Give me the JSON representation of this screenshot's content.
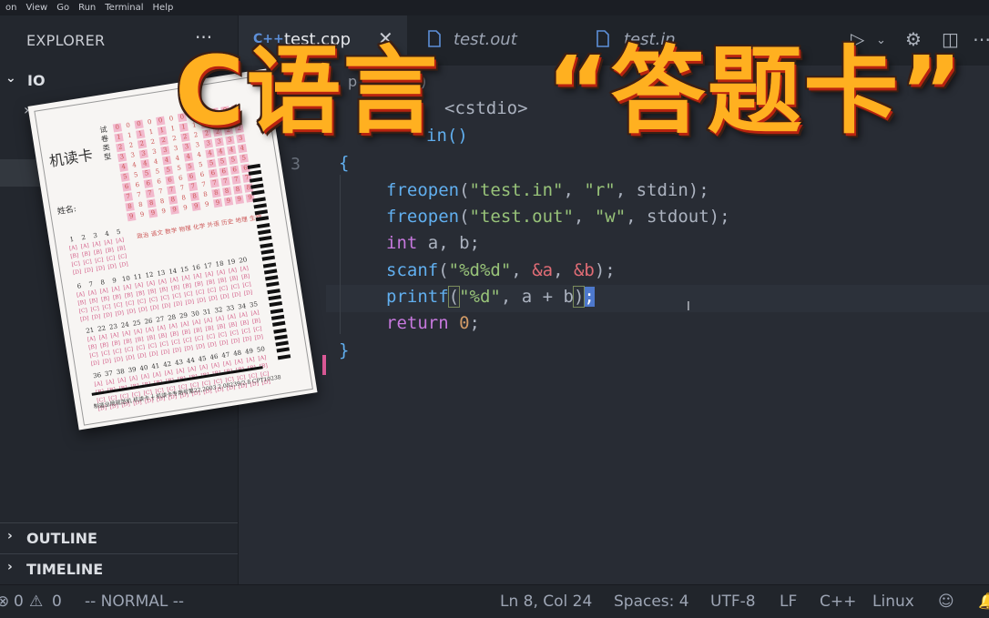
{
  "menubar": [
    "on",
    "View",
    "Go",
    "Run",
    "Terminal",
    "Help"
  ],
  "sidebar": {
    "title": "EXPLORER",
    "more": "···",
    "folder": "IO",
    "outline": "OUTLINE",
    "timeline": "TIMELINE"
  },
  "tabs": [
    {
      "label": "test.cpp",
      "icon": "C++",
      "active": true
    },
    {
      "label": "test.out",
      "icon": "file-icon",
      "active": false
    },
    {
      "label": "test.in",
      "icon": "file-icon",
      "active": false
    }
  ],
  "editor": {
    "breadcrumb_fragment": "p > main()",
    "line_numbers": [
      "3"
    ],
    "lines": [
      [
        "",
        "#",
        "in",
        "clude <cstdio>"
      ],
      [
        "ma",
        "in()"
      ]
    ]
  },
  "code": {
    "open_brace": "{",
    "close_brace": "}",
    "l1_fn": "freopen",
    "l1_args": [
      "\"test.in\"",
      "\"r\"",
      "stdin"
    ],
    "l2_fn": "freopen",
    "l2_args": [
      "\"test.out\"",
      "\"w\"",
      "stdout"
    ],
    "l3_kw": "int",
    "l3_rest": "a, b;",
    "l4_fn": "scanf",
    "l4_fmt": "\"%d%d\"",
    "l4_a": "&a",
    "l4_b": "&b",
    "l5_fn": "printf",
    "l5_fmt": "\"%d\"",
    "l5_expr": "a + b",
    "l6_kw": "return",
    "l6_val": "0",
    "include_text": "<cstdio>",
    "main_text": "in()"
  },
  "statusbar": {
    "errors": "0",
    "warnings": "0",
    "mode": "-- NORMAL --",
    "position": "Ln 8, Col 24",
    "spaces": "Spaces: 4",
    "encoding": "UTF-8",
    "eol": "LF",
    "language": "C++",
    "platform": "Linux"
  },
  "overlay": {
    "title_left": "C语言",
    "title_right": "“答题卡”"
  },
  "answer_card": {
    "title": "机读卡",
    "name_label": "姓名:",
    "side_label": "试卷类型",
    "subjects": "政治 语文 数学 物理 化学 外语 历史 地理 生物",
    "digits": [
      "0",
      "1",
      "2",
      "3",
      "4",
      "5",
      "6",
      "7",
      "8",
      "9"
    ],
    "question_numbers_row1": [
      "1",
      "2",
      "3",
      "4",
      "5"
    ],
    "question_numbers_row2": [
      "6",
      "7",
      "8",
      "9",
      "10",
      "11",
      "12",
      "13",
      "14",
      "15",
      "16",
      "17",
      "18",
      "19",
      "20"
    ],
    "question_numbers_row3": [
      "21",
      "22",
      "23",
      "24",
      "25",
      "26",
      "27",
      "28",
      "29",
      "30",
      "31",
      "32",
      "33",
      "34",
      "35"
    ],
    "question_numbers_row4": [
      "36",
      "37",
      "38",
      "39",
      "40",
      "41",
      "42",
      "43",
      "44",
      "45",
      "46",
      "47",
      "48",
      "49",
      "50"
    ],
    "options": [
      "A",
      "B",
      "C",
      "D"
    ],
    "footer": "制造业局规范机  机读卡  ┼  机读卡专用号第22,2003 2.08239/2.8  CPT10238"
  },
  "colors": {
    "editor_bg": "#282c34",
    "keyword": "#c678dd",
    "function": "#61afef",
    "string": "#98c379",
    "number": "#d19a66",
    "overlay_fill": "#ffb020",
    "card_pink": "#f2b9cd"
  }
}
